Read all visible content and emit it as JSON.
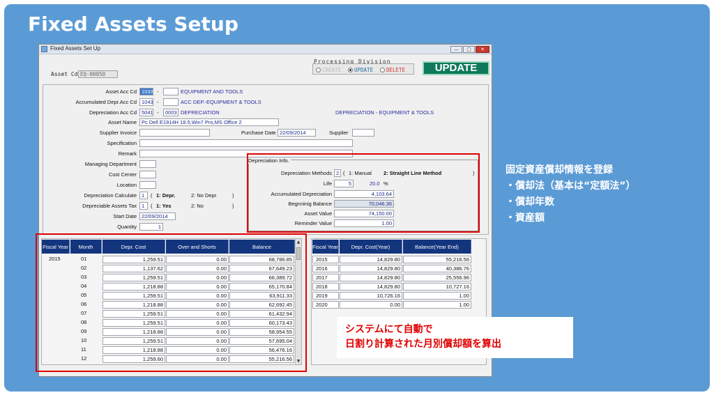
{
  "slide": {
    "title": "Fixed Assets Setup",
    "note_lines": [
      "固定資産償却情報を登録",
      "・償却法（基本は“定額法”）",
      "・償却年数",
      "・資産額"
    ],
    "callout_lines": [
      "システムにて自動で",
      "日割り計算された月別償却額を算出"
    ]
  },
  "window": {
    "title": "Fixed Assets Set Up",
    "controls": {
      "minimize": "—",
      "maximize": "▢",
      "close": "✕"
    }
  },
  "header": {
    "asset_cd_label": "Asset Cd",
    "asset_cd_value": "EQ-00050",
    "processing_division_label": "Processing Division",
    "radio_create": "CREATE",
    "radio_update": "UPDATE",
    "radio_delete": "DELETE",
    "update_button": "UPDATE"
  },
  "form": {
    "asset_acc_cd_label": "Asset Acc Cd",
    "asset_acc_cd": "1033",
    "asset_acc_name": "EQUIPMENT AND TOOLS",
    "acc_depr_label": "Accumulated Depr.Acc Cd",
    "acc_depr_cd": "1043",
    "acc_depr_name": "ACC DEP.-EQUIPMENT & TOOLS",
    "depr_acc_label": "Depreciation Acc Cd",
    "depr_acc_cd": "5041",
    "depr_acc_sub": "0003",
    "depr_acc_name": "DEPRECIATION",
    "depr_acc_desc": "DEPRECIATION - EQUIPMENT & TOOLS",
    "dash": "-",
    "asset_name_label": "Asset Name",
    "asset_name": "Pc Dell E1914H 18.5,Win7 Pro,MS Office 2",
    "supplier_invoice_label": "Supplier Invoice",
    "purchase_date_label": "Purchase Date",
    "purchase_date": "22/09/2014",
    "supplier_label": "Supplier",
    "specification_label": "Specification",
    "remark_label": "Remark",
    "managing_dept_label": "Managing Department",
    "cost_center_label": "Cost Center",
    "location_label": "Location",
    "depr_calc_label": "Depreciation Calculate",
    "depr_calc_value": "1",
    "depr_calc_open": "(",
    "depr_calc_opt1": "1: Depr.",
    "depr_calc_opt2": "2: No Depr.",
    "depr_calc_close": ")",
    "depr_tax_label": "Depreciable Assets Tax",
    "depr_tax_value": "1",
    "depr_tax_open": "(",
    "depr_tax_opt1": "1: Yes",
    "depr_tax_opt2": "2: No",
    "depr_tax_close": ")",
    "start_date_label": "Start Date",
    "start_date": "22/09/2014",
    "quantity_label": "Quantity",
    "quantity": "1"
  },
  "depreciation": {
    "section_label": "Depreciation Info.",
    "methods_label": "Depreciation Methods",
    "methods_value": "2",
    "methods_open": "(",
    "method_1": "1: Manual",
    "method_2": "2: Straight Line Method",
    "methods_close": ")",
    "life_label": "Life",
    "life_value": "5",
    "life_rate": "20.0",
    "life_unit": "%",
    "accumulated_label": "Accumulated Depreciation",
    "accumulated_value": "4,103.64",
    "beginning_label": "Begnninig Balance",
    "beginning_value": "70,046.36",
    "asset_value_label": "Asset Value",
    "asset_value": "74,150.00",
    "reminder_label": "Reminder Value",
    "reminder_value": "1.00"
  },
  "monthly_table": {
    "headers": [
      "Fiscal Year",
      "Month",
      "Depr. Cost",
      "Over and Shorts",
      "Balance"
    ],
    "fiscal_year": "2015",
    "rows": [
      {
        "month": "01",
        "cost": "1,259.51",
        "over": "0.00",
        "balance": "68,786.85"
      },
      {
        "month": "02",
        "cost": "1,137.62",
        "over": "0.00",
        "balance": "67,649.23"
      },
      {
        "month": "03",
        "cost": "1,259.51",
        "over": "0.00",
        "balance": "66,389.72"
      },
      {
        "month": "04",
        "cost": "1,218.88",
        "over": "0.00",
        "balance": "65,170.84"
      },
      {
        "month": "05",
        "cost": "1,259.51",
        "over": "0.00",
        "balance": "63,911.33"
      },
      {
        "month": "06",
        "cost": "1,218.88",
        "over": "0.00",
        "balance": "62,692.45"
      },
      {
        "month": "07",
        "cost": "1,259.51",
        "over": "0.00",
        "balance": "61,432.94"
      },
      {
        "month": "08",
        "cost": "1,259.51",
        "over": "0.00",
        "balance": "60,173.43"
      },
      {
        "month": "09",
        "cost": "1,218.88",
        "over": "0.00",
        "balance": "58,954.55"
      },
      {
        "month": "10",
        "cost": "1,259.51",
        "over": "0.00",
        "balance": "57,695.04"
      },
      {
        "month": "11",
        "cost": "1,218.88",
        "over": "0.00",
        "balance": "56,476.16"
      },
      {
        "month": "12",
        "cost": "1,259.60",
        "over": "0.00",
        "balance": "55,216.56"
      }
    ]
  },
  "yearly_table": {
    "headers": [
      "Fiscal Year",
      "Depr. Cost(Year)",
      "Balance(Year End)"
    ],
    "rows": [
      {
        "year": "2015",
        "cost": "14,829.80",
        "balance": "55,216.56"
      },
      {
        "year": "2016",
        "cost": "14,829.80",
        "balance": "40,386.76"
      },
      {
        "year": "2017",
        "cost": "14,829.80",
        "balance": "25,556.96"
      },
      {
        "year": "2018",
        "cost": "14,829.80",
        "balance": "10,727.16"
      },
      {
        "year": "2019",
        "cost": "10,726.16",
        "balance": "1.00"
      },
      {
        "year": "2020",
        "cost": "0.00",
        "balance": "1.00"
      }
    ]
  },
  "colors": {
    "slide_bg": "#5b9bd5",
    "grid_header": "#13357e",
    "update_button": "#0e7a5a",
    "highlight": "#e00000"
  }
}
